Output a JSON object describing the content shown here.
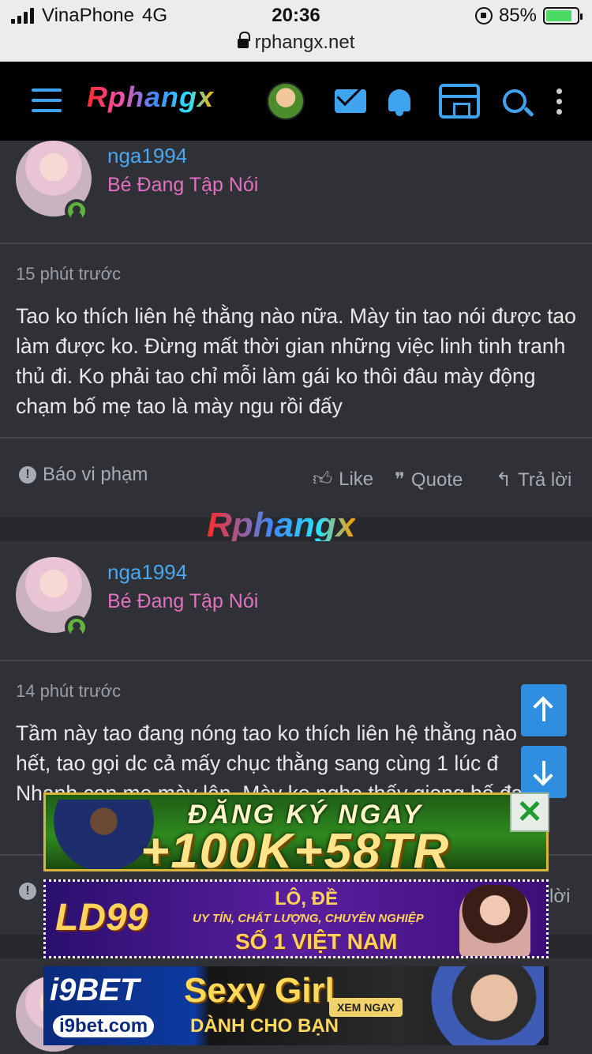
{
  "status_bar": {
    "carrier": "VinaPhone",
    "network": "4G",
    "time": "20:36",
    "battery": "85%",
    "battery_level": 0.85,
    "url": "rphangx.net"
  },
  "header": {
    "logo_text": "Rphangx",
    "icons": [
      "menu-icon",
      "avatar",
      "mail-icon",
      "bell-icon",
      "store-icon",
      "search-icon",
      "more-icon"
    ]
  },
  "posts": [
    {
      "username": "nga1994",
      "user_title": "Bé Đang Tập Nói",
      "time": "15 phút trước",
      "text": "Tao ko thích liên hệ thằng nào nữa. Mày tin tao nói được tao làm được ko. Đừng mất thời gian những việc linh tinh tranh thủ đi. Ko phải tao chỉ mỗi làm gái ko thôi đâu mày động chạm bố mẹ tao là mày ngu rồi đấy",
      "actions": {
        "report": "Báo vi phạm",
        "like": "Like",
        "quote": "Quote",
        "reply": "Trả lời"
      }
    },
    {
      "username": "nga1994",
      "user_title": "Bé Đang Tập Nói",
      "time": "14 phút trước",
      "text_visible": "Tầm này tao đang nóng tao ko thích liên hệ thằng nào hết, tao gọi dc cả mấy chục thằng sang cùng 1 lúc đ Nhanh con mẹ mày lên. Mày ko nghe thấy giọng bố đa",
      "actions": {
        "reply": "lời"
      }
    }
  ],
  "watermark": "Rphangx",
  "ads": {
    "ad1": {
      "line1": "ĐĂNG KÝ NGAY",
      "line2": "+100K+58TR",
      "close": "✕"
    },
    "ad2": {
      "brand": "LD99",
      "line1": "LÔ, ĐỀ",
      "line2": "UY TÍN, CHẤT LƯỢNG, CHUYÊN NGHIỆP",
      "line3": "SỐ 1 VIỆT NAM"
    },
    "ad3": {
      "brand": "i9BET",
      "domain": "i9bet.com",
      "title": "Sexy Girl",
      "subtitle": "DÀNH CHO BẠN",
      "button": "XEM NGAY"
    }
  },
  "colors": {
    "accent": "#3ea4f0",
    "username": "#4aa6ee",
    "user_title": "#e371c2",
    "background": "#2f3136"
  }
}
